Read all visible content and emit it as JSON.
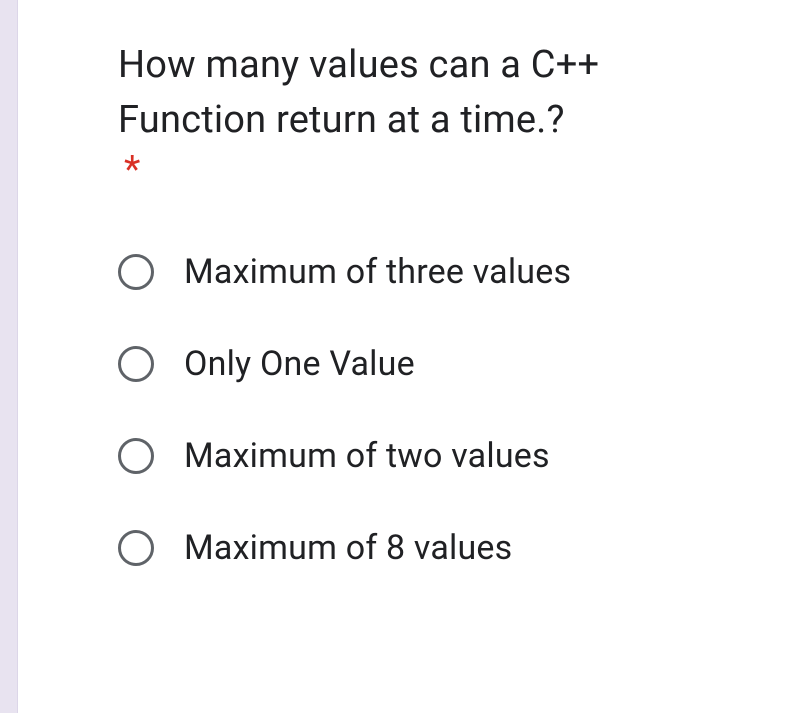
{
  "question": {
    "text": "How many values can a C++ Function return at a time.?",
    "required_mark": "*"
  },
  "options": [
    {
      "label": "Maximum of three values"
    },
    {
      "label": "Only One Value"
    },
    {
      "label": "Maximum of two values"
    },
    {
      "label": "Maximum of 8 values"
    }
  ]
}
